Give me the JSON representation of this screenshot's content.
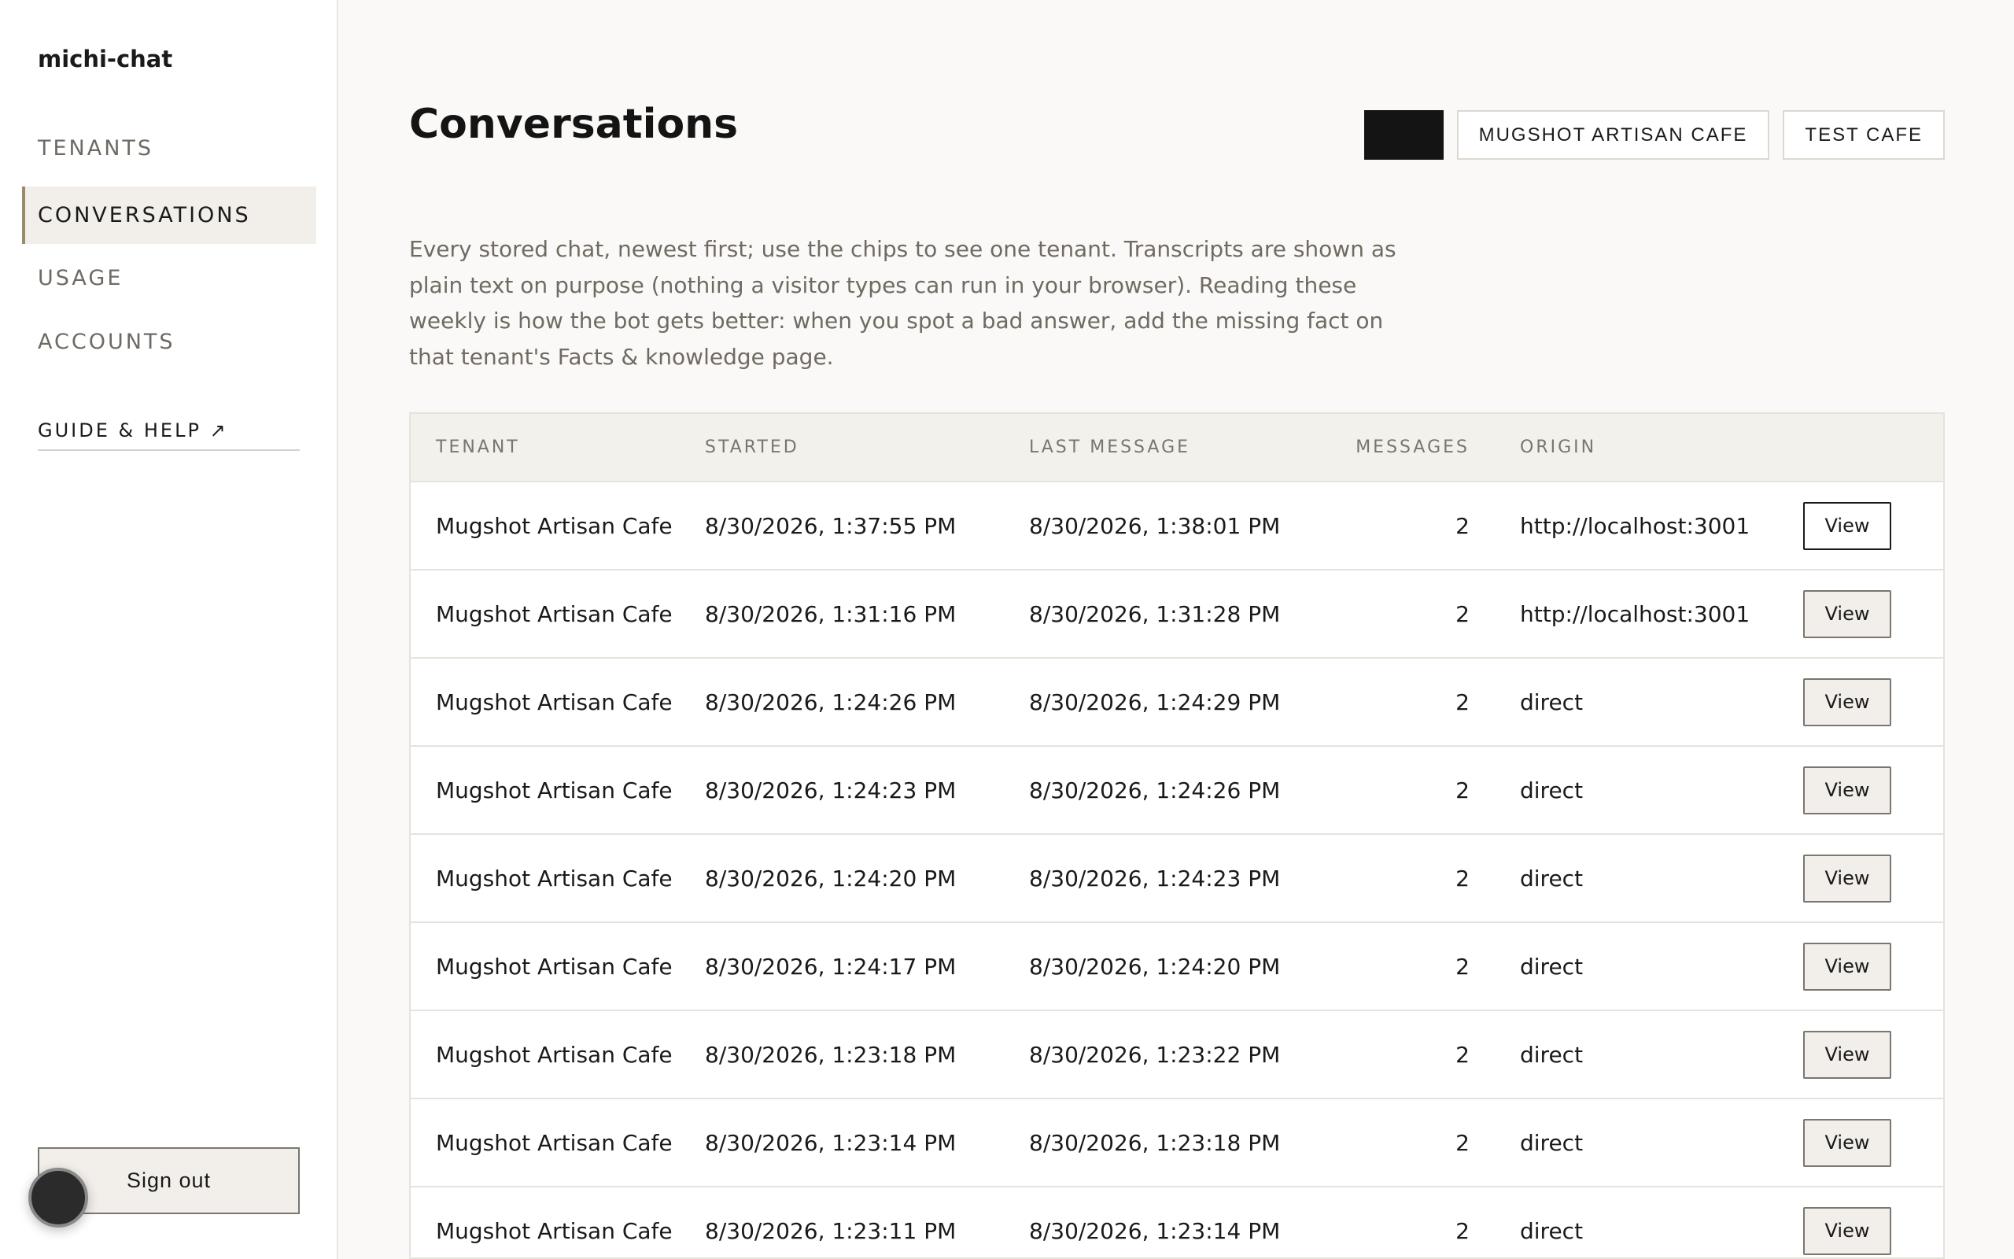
{
  "app": {
    "name": "michi-chat"
  },
  "sidebar": {
    "items": [
      {
        "label": "TENANTS",
        "active": false
      },
      {
        "label": "CONVERSATIONS",
        "active": true
      },
      {
        "label": "USAGE",
        "active": false
      },
      {
        "label": "ACCOUNTS",
        "active": false
      }
    ],
    "guide_label": "GUIDE & HELP ↗",
    "signout_label": "Sign out"
  },
  "main": {
    "title": "Conversations",
    "chips": [
      {
        "label": "",
        "active": true
      },
      {
        "label": "MUGSHOT ARTISAN CAFE",
        "active": false
      },
      {
        "label": "TEST CAFE",
        "active": false
      }
    ],
    "intro": "Every stored chat, newest first; use the chips to see one tenant. Transcripts are shown as plain text on purpose (nothing a visitor types can run in your browser). Reading these weekly is how the bot gets better: when you spot a bad answer, add the missing fact on that tenant's Facts & knowledge page.",
    "table": {
      "headers": {
        "tenant": "TENANT",
        "started": "STARTED",
        "last": "LAST MESSAGE",
        "messages": "MESSAGES",
        "origin": "ORIGIN"
      },
      "view_label": "View",
      "rows": [
        {
          "tenant": "Mugshot Artisan Cafe",
          "started": "8/30/2026, 1:37:55 PM",
          "last": "8/30/2026, 1:38:01 PM",
          "messages": "2",
          "origin": "http://localhost:3001"
        },
        {
          "tenant": "Mugshot Artisan Cafe",
          "started": "8/30/2026, 1:31:16 PM",
          "last": "8/30/2026, 1:31:28 PM",
          "messages": "2",
          "origin": "http://localhost:3001"
        },
        {
          "tenant": "Mugshot Artisan Cafe",
          "started": "8/30/2026, 1:24:26 PM",
          "last": "8/30/2026, 1:24:29 PM",
          "messages": "2",
          "origin": "direct"
        },
        {
          "tenant": "Mugshot Artisan Cafe",
          "started": "8/30/2026, 1:24:23 PM",
          "last": "8/30/2026, 1:24:26 PM",
          "messages": "2",
          "origin": "direct"
        },
        {
          "tenant": "Mugshot Artisan Cafe",
          "started": "8/30/2026, 1:24:20 PM",
          "last": "8/30/2026, 1:24:23 PM",
          "messages": "2",
          "origin": "direct"
        },
        {
          "tenant": "Mugshot Artisan Cafe",
          "started": "8/30/2026, 1:24:17 PM",
          "last": "8/30/2026, 1:24:20 PM",
          "messages": "2",
          "origin": "direct"
        },
        {
          "tenant": "Mugshot Artisan Cafe",
          "started": "8/30/2026, 1:23:18 PM",
          "last": "8/30/2026, 1:23:22 PM",
          "messages": "2",
          "origin": "direct"
        },
        {
          "tenant": "Mugshot Artisan Cafe",
          "started": "8/30/2026, 1:23:14 PM",
          "last": "8/30/2026, 1:23:18 PM",
          "messages": "2",
          "origin": "direct"
        },
        {
          "tenant": "Mugshot Artisan Cafe",
          "started": "8/30/2026, 1:23:11 PM",
          "last": "8/30/2026, 1:23:14 PM",
          "messages": "2",
          "origin": "direct"
        }
      ]
    }
  }
}
